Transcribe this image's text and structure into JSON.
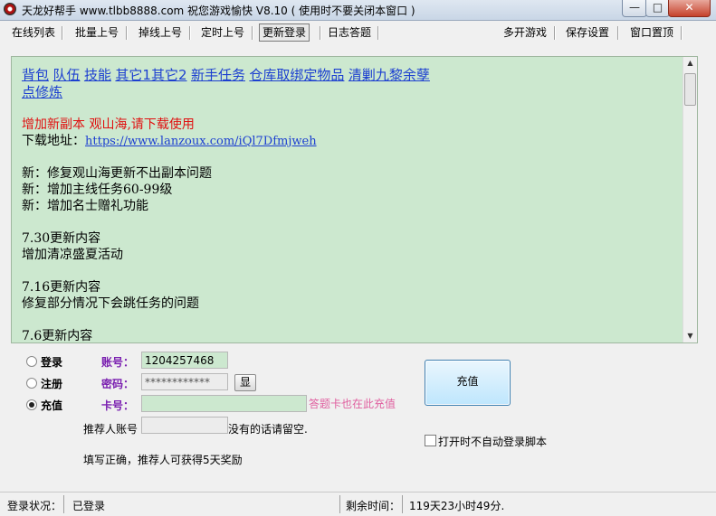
{
  "window": {
    "title": "天龙好帮手 www.tlbb8888.com 祝您游戏愉快 V8.10 ( 使用时不要关闭本窗口 )",
    "min_label": "—",
    "max_label": "□",
    "close_label": "✕"
  },
  "toolbar": {
    "items": [
      "在线列表",
      "批量上号",
      "掉线上号",
      "定时上号",
      "更新登录",
      "日志答题",
      "多开游戏",
      "保存设置",
      "窗口置顶"
    ]
  },
  "content": {
    "links": [
      "背包",
      "队伍",
      "技能",
      "其它1",
      "其它2",
      "新手任务",
      "仓库取绑定物品",
      "清剿九黎余孽",
      "点修炼"
    ],
    "notice": "增加新副本  观山海,请下载使用",
    "download_label": "下载地址：",
    "download_url": "https://www.lanzoux.com/iQl7Dfmjweh",
    "new1": "新：修复观山海更新不出副本问题",
    "new2": "新：增加主线任务60-99级",
    "new3": "新：增加名士赠礼功能",
    "v730_title": "7.30更新内容",
    "v730_line": "增加清凉盛夏活动",
    "v716_title": "7.16更新内容",
    "v716_line": "修复部分情况下会跳任务的问题",
    "v76_title": "7.6更新内容"
  },
  "form": {
    "radio_login": "登录",
    "radio_register": "注册",
    "radio_recharge": "充值",
    "selected": "充值",
    "account_label": "账号：",
    "account_value": "1204257468",
    "password_label": "密码：",
    "password_value": "************",
    "show_button": "显",
    "card_label": "卡号：",
    "card_value": "",
    "card_hint": "答题卡也在此充值",
    "referrer_label": "推荐人账号",
    "referrer_value": "",
    "referrer_note": "没有的话请留空.",
    "reward_note": "填写正确，推荐人可获得5天奖励",
    "recharge_button": "充值",
    "auto_login_checkbox": "打开时不自动登录脚本",
    "auto_login_checked": false
  },
  "status": {
    "login_label": "登录状况：",
    "login_value": "已登录",
    "remaining_label": "剩余时间：",
    "remaining_value": "119天23小时49分."
  }
}
